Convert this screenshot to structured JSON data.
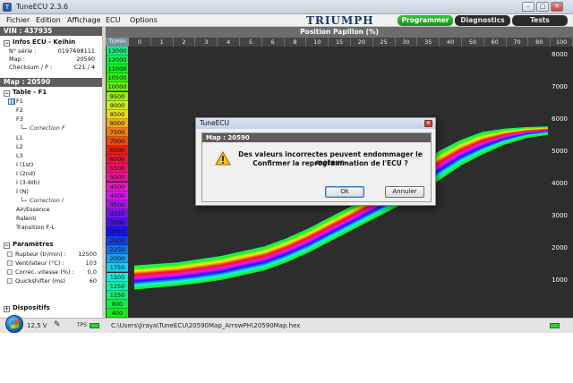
{
  "window": {
    "title": "TuneECU 2.3.6"
  },
  "menu": [
    "Fichier",
    "Edition",
    "Affichage",
    "ECU",
    "Options"
  ],
  "brand": "TRIUMPH",
  "top_tabs": [
    {
      "label": "Programmer",
      "active": true
    },
    {
      "label": "Diagnostics",
      "active": false
    },
    {
      "label": "Tests",
      "active": false
    }
  ],
  "left": {
    "vin": "VIN : 437935",
    "infos_title": "Infos ECU - Keihin",
    "infos": [
      {
        "label": "N° série :",
        "value": "0197498111"
      },
      {
        "label": "Map :",
        "value": "20590"
      },
      {
        "label": "Checksum / P :",
        "value": "C21 / 4"
      }
    ],
    "map_header": "Map : 20590",
    "table_title": "Table - F1",
    "tables": [
      "F1",
      "F2",
      "F3",
      "Correction F",
      "L1",
      "L2",
      "L3",
      "I (1st)",
      "I (2nd)",
      "I (3-6th)",
      "I (N)",
      "Correction I",
      "Air/Essence",
      "Ralenti",
      "Transition F-L"
    ],
    "params_title": "Paramètres",
    "params": [
      {
        "label": "Rupteur (tr/min) :",
        "value": "12500"
      },
      {
        "label": "Ventilateur (°C) :",
        "value": "103"
      },
      {
        "label": "Correc. vitesse (%) :",
        "value": "0,0"
      },
      {
        "label": "Quickshifter (ms)",
        "value": "60"
      }
    ],
    "dispositifs": "Dispositifs"
  },
  "chart_data": {
    "type": "line",
    "title": "Position Papillon (%)",
    "rpm_header": "Tr/min",
    "throttle": [
      "0",
      "1",
      "2",
      "3",
      "4",
      "5",
      "6",
      "8",
      "10",
      "15",
      "20",
      "25",
      "30",
      "35",
      "40",
      "50",
      "60",
      "70",
      "80",
      "100"
    ],
    "rpm": [
      "13000",
      "12000",
      "11000",
      "10500",
      "10000",
      "9500",
      "9000",
      "8500",
      "8000",
      "7500",
      "7000",
      "6500",
      "6000",
      "5500",
      "5000",
      "4500",
      "4000",
      "3500",
      "3250",
      "3000",
      "2750",
      "2500",
      "2250",
      "2000",
      "1750",
      "1500",
      "1250",
      "1150",
      "800",
      "400"
    ],
    "yticks": [
      "8000",
      "7000",
      "6000",
      "5000",
      "4000",
      "3000",
      "2000",
      "1000"
    ],
    "ylim": [
      0,
      8000
    ],
    "series_low": [
      1400,
      1450,
      1500,
      1600,
      1700,
      1850,
      2000,
      2250,
      2550,
      2900,
      3250,
      3600,
      4000,
      4450,
      4950,
      5300,
      5550,
      5650,
      5700,
      5720
    ],
    "series_high": [
      700,
      760,
      820,
      900,
      1000,
      1150,
      1300,
      1550,
      1850,
      2200,
      2550,
      2900,
      3250,
      3650,
      4100,
      4550,
      4900,
      5200,
      5400,
      5500
    ]
  },
  "dialog": {
    "window_title": "TuneECU",
    "header": "Map : 20590",
    "line1": "Des valeurs incorrectes peuvent endommager le moteur.",
    "line2": "Confirmer la reprogrammation de l'ECU ?",
    "ok": "Ok",
    "cancel": "Annuler"
  },
  "status": {
    "voltage": "12,5 V",
    "tps": "TPS",
    "path": "C:\\Users\\Jiraya\\TuneECU\\20590Map_ArrowPH\\20590Map.hex"
  }
}
